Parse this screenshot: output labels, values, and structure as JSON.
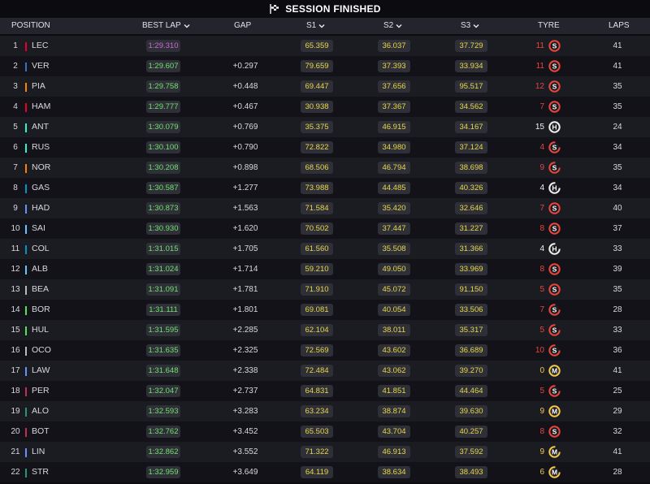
{
  "session": {
    "title": "SESSION FINISHED"
  },
  "columns": {
    "position": "POSITION",
    "best_lap": "BEST LAP",
    "gap": "GAP",
    "s1": "S1",
    "s2": "S2",
    "s3": "S3",
    "tyre": "TYRE",
    "laps": "LAPS"
  },
  "colors": {
    "best_overall": "#c96ad8",
    "personal_best": "#6fe26f",
    "sector_yellow": "#e8d84a",
    "tyre_soft": "#e8453c",
    "tyre_medium": "#f2c94c",
    "tyre_hard": "#f0f0f0"
  },
  "rows": [
    {
      "pos": "1",
      "driver": "LEC",
      "team_color": "#e8002d",
      "best_lap": "1:29.310",
      "lap_color": "purple",
      "gap": "",
      "s1": "65.359",
      "s2": "36.037",
      "s3": "37.729",
      "tyre_count": "11",
      "tyre": "S",
      "tyre_new": true,
      "laps": "41"
    },
    {
      "pos": "2",
      "driver": "VER",
      "team_color": "#3671c6",
      "best_lap": "1:29.607",
      "lap_color": "green",
      "gap": "+0.297",
      "s1": "79.659",
      "s2": "37.393",
      "s3": "33.934",
      "tyre_count": "11",
      "tyre": "S",
      "tyre_new": true,
      "laps": "41"
    },
    {
      "pos": "3",
      "driver": "PIA",
      "team_color": "#ff8000",
      "best_lap": "1:29.758",
      "lap_color": "green",
      "gap": "+0.448",
      "s1": "69.447",
      "s2": "37.656",
      "s3": "95.517",
      "tyre_count": "12",
      "tyre": "S",
      "tyre_new": true,
      "laps": "35"
    },
    {
      "pos": "4",
      "driver": "HAM",
      "team_color": "#e8002d",
      "best_lap": "1:29.777",
      "lap_color": "green",
      "gap": "+0.467",
      "s1": "30.938",
      "s2": "37.367",
      "s3": "34.562",
      "tyre_count": "7",
      "tyre": "S",
      "tyre_new": true,
      "laps": "35"
    },
    {
      "pos": "5",
      "driver": "ANT",
      "team_color": "#27f4d2",
      "best_lap": "1:30.079",
      "lap_color": "green",
      "gap": "+0.769",
      "s1": "35.375",
      "s2": "46.915",
      "s3": "34.167",
      "tyre_count": "15",
      "tyre": "H",
      "tyre_new": true,
      "laps": "24"
    },
    {
      "pos": "6",
      "driver": "RUS",
      "team_color": "#27f4d2",
      "best_lap": "1:30.100",
      "lap_color": "green",
      "gap": "+0.790",
      "s1": "72.822",
      "s2": "34.980",
      "s3": "37.124",
      "tyre_count": "4",
      "tyre": "S",
      "tyre_new": false,
      "laps": "34"
    },
    {
      "pos": "7",
      "driver": "NOR",
      "team_color": "#ff8000",
      "best_lap": "1:30.208",
      "lap_color": "green",
      "gap": "+0.898",
      "s1": "68.506",
      "s2": "46.794",
      "s3": "38.698",
      "tyre_count": "9",
      "tyre": "S",
      "tyre_new": false,
      "laps": "35"
    },
    {
      "pos": "8",
      "driver": "GAS",
      "team_color": "#0093cc",
      "best_lap": "1:30.587",
      "lap_color": "green",
      "gap": "+1.277",
      "s1": "73.988",
      "s2": "44.485",
      "s3": "40.326",
      "tyre_count": "4",
      "tyre": "H",
      "tyre_new": false,
      "laps": "34"
    },
    {
      "pos": "9",
      "driver": "HAD",
      "team_color": "#6692ff",
      "best_lap": "1:30.873",
      "lap_color": "green",
      "gap": "+1.563",
      "s1": "71.584",
      "s2": "35.420",
      "s3": "32.646",
      "tyre_count": "7",
      "tyre": "S",
      "tyre_new": true,
      "laps": "40"
    },
    {
      "pos": "10",
      "driver": "SAI",
      "team_color": "#64c4ff",
      "best_lap": "1:30.930",
      "lap_color": "green",
      "gap": "+1.620",
      "s1": "70.502",
      "s2": "37.447",
      "s3": "31.227",
      "tyre_count": "8",
      "tyre": "S",
      "tyre_new": true,
      "laps": "37"
    },
    {
      "pos": "11",
      "driver": "COL",
      "team_color": "#0093cc",
      "best_lap": "1:31.015",
      "lap_color": "green",
      "gap": "+1.705",
      "s1": "61.560",
      "s2": "35.508",
      "s3": "31.366",
      "tyre_count": "4",
      "tyre": "H",
      "tyre_new": false,
      "laps": "33"
    },
    {
      "pos": "12",
      "driver": "ALB",
      "team_color": "#64c4ff",
      "best_lap": "1:31.024",
      "lap_color": "green",
      "gap": "+1.714",
      "s1": "59.210",
      "s2": "49.050",
      "s3": "33.969",
      "tyre_count": "8",
      "tyre": "S",
      "tyre_new": true,
      "laps": "39"
    },
    {
      "pos": "13",
      "driver": "BEA",
      "team_color": "#b6babd",
      "best_lap": "1:31.091",
      "lap_color": "green",
      "gap": "+1.781",
      "s1": "71.910",
      "s2": "45.072",
      "s3": "91.150",
      "tyre_count": "5",
      "tyre": "S",
      "tyre_new": true,
      "laps": "35"
    },
    {
      "pos": "14",
      "driver": "BOR",
      "team_color": "#52e252",
      "best_lap": "1:31.111",
      "lap_color": "green",
      "gap": "+1.801",
      "s1": "69.081",
      "s2": "40.054",
      "s3": "33.506",
      "tyre_count": "7",
      "tyre": "S",
      "tyre_new": false,
      "laps": "28"
    },
    {
      "pos": "15",
      "driver": "HUL",
      "team_color": "#52e252",
      "best_lap": "1:31.595",
      "lap_color": "green",
      "gap": "+2.285",
      "s1": "62.104",
      "s2": "38.011",
      "s3": "35.317",
      "tyre_count": "5",
      "tyre": "S",
      "tyre_new": false,
      "laps": "33"
    },
    {
      "pos": "16",
      "driver": "OCO",
      "team_color": "#b6babd",
      "best_lap": "1:31.635",
      "lap_color": "green",
      "gap": "+2.325",
      "s1": "72.569",
      "s2": "43.602",
      "s3": "36.689",
      "tyre_count": "10",
      "tyre": "S",
      "tyre_new": false,
      "laps": "36"
    },
    {
      "pos": "17",
      "driver": "LAW",
      "team_color": "#6692ff",
      "best_lap": "1:31.648",
      "lap_color": "green",
      "gap": "+2.338",
      "s1": "72.484",
      "s2": "43.062",
      "s3": "39.270",
      "tyre_count": "0",
      "tyre": "M",
      "tyre_new": true,
      "laps": "41"
    },
    {
      "pos": "18",
      "driver": "PER",
      "team_color": "#c92d4b",
      "best_lap": "1:32.047",
      "lap_color": "green",
      "gap": "+2.737",
      "s1": "64.831",
      "s2": "41.851",
      "s3": "44.464",
      "tyre_count": "5",
      "tyre": "S",
      "tyre_new": false,
      "laps": "25"
    },
    {
      "pos": "19",
      "driver": "ALO",
      "team_color": "#229971",
      "best_lap": "1:32.593",
      "lap_color": "green",
      "gap": "+3.283",
      "s1": "63.234",
      "s2": "38.874",
      "s3": "39.630",
      "tyre_count": "9",
      "tyre": "M",
      "tyre_new": true,
      "laps": "29"
    },
    {
      "pos": "20",
      "driver": "BOT",
      "team_color": "#c92d4b",
      "best_lap": "1:32.762",
      "lap_color": "green",
      "gap": "+3.452",
      "s1": "65.503",
      "s2": "43.704",
      "s3": "40.257",
      "tyre_count": "8",
      "tyre": "S",
      "tyre_new": true,
      "laps": "32"
    },
    {
      "pos": "21",
      "driver": "LIN",
      "team_color": "#6692ff",
      "best_lap": "1:32.862",
      "lap_color": "green",
      "gap": "+3.552",
      "s1": "71.322",
      "s2": "46.913",
      "s3": "37.592",
      "tyre_count": "9",
      "tyre": "M",
      "tyre_new": false,
      "laps": "41"
    },
    {
      "pos": "22",
      "driver": "STR",
      "team_color": "#229971",
      "best_lap": "1:32.959",
      "lap_color": "green",
      "gap": "+3.649",
      "s1": "64.119",
      "s2": "38.634",
      "s3": "38.493",
      "tyre_count": "6",
      "tyre": "M",
      "tyre_new": false,
      "laps": "28"
    }
  ]
}
